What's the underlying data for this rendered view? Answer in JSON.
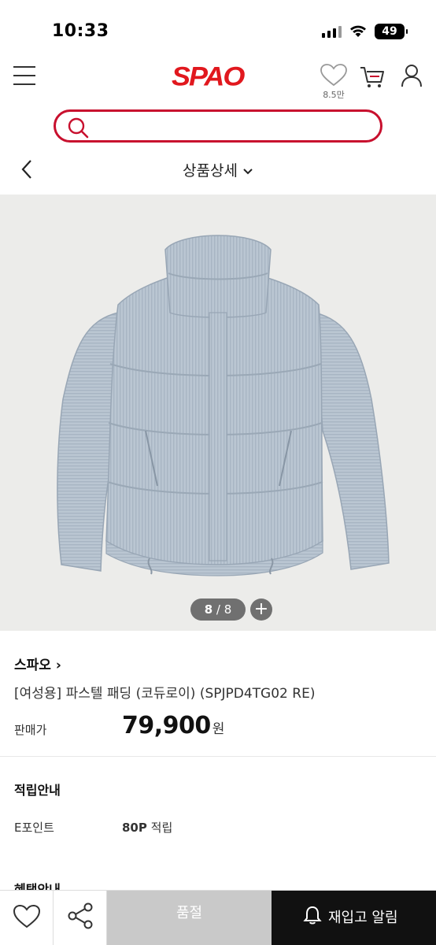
{
  "status_bar": {
    "time": "10:33",
    "battery": "49"
  },
  "header": {
    "logo": "SPAO",
    "like_count": "8.5만"
  },
  "search": {
    "placeholder": ""
  },
  "subheader": {
    "title": "상품상세"
  },
  "gallery": {
    "current": "8",
    "total": "8",
    "separator": "/",
    "plus": "+"
  },
  "product": {
    "brand": "스파오",
    "brand_arrow": "›",
    "name": "[여성용] 파스텔 패딩 (코듀로이) (SPJPD4TG02 RE)",
    "price_label": "판매가",
    "price": "79,900",
    "price_unit": "원"
  },
  "points": {
    "title": "적립안내",
    "label": "E포인트",
    "value": "80P",
    "value_suffix": "적립"
  },
  "benefits": {
    "title": "혜택안내"
  },
  "bottom_bar": {
    "soldout_label": "품절",
    "restock_label": "재입고 알림"
  },
  "colors": {
    "brand_red": "#e1181e",
    "search_border": "#c8102e",
    "jacket": "#b9c6d3",
    "soldout_bg": "#c9c9c9",
    "restock_bg": "#111111"
  }
}
